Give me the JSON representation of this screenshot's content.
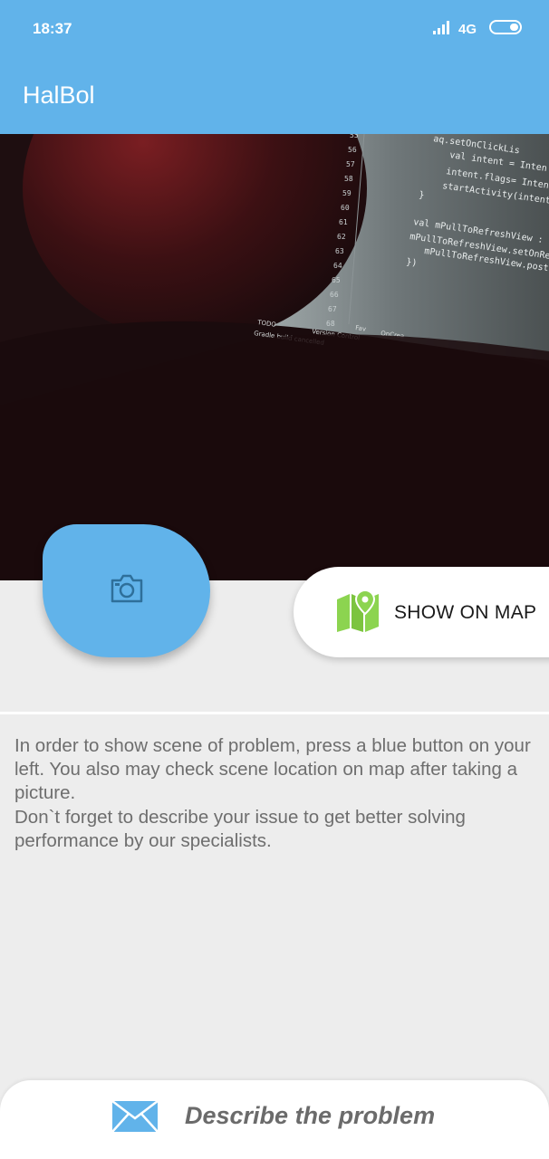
{
  "status_bar": {
    "time": "18:37",
    "network": "4G",
    "icons": [
      "signal-icon",
      "battery-icon"
    ]
  },
  "app_bar": {
    "title": "HalBol",
    "color": "#61b3ea"
  },
  "photo_preview": {
    "description_icon": "camera-photo",
    "code_lines": [
      "...aq.setOnClickLis",
      "val intent = Inten",
      "intent.flags= Inten",
      "startActivity(intent",
      "}",
      "val mPullToRefreshView : Pul",
      "mPullToRefreshView.setOnRef",
      "mPullToRefreshView.post",
      "})"
    ],
    "line_numbers": [
      "55",
      "56",
      "57",
      "58",
      "59",
      "60",
      "61",
      "62",
      "63",
      "64",
      "65",
      "66",
      "67",
      "68"
    ],
    "status_texts": [
      "TODO",
      "Version Control",
      "Gradle build cancelled",
      "Fav",
      "OnCrea"
    ]
  },
  "actions": {
    "camera_icon": "camera-icon",
    "show_on_map_label": "SHOW ON MAP",
    "map_icon": "map-pin-icon",
    "map_icon_color": "#8cd450"
  },
  "instructions": {
    "text": "In order to show scene of problem, press a blue button on your left. You also may check scene location on map after taking a picture.\n Don`t forget to describe your issue to get better solving performance by our specialists."
  },
  "bottom_bar": {
    "describe_label": "Describe the problem",
    "mail_icon": "envelope-icon",
    "mail_icon_color": "#61b3ea"
  }
}
